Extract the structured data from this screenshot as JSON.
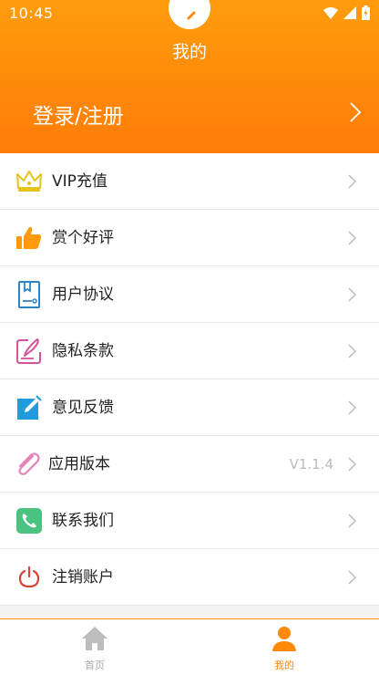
{
  "status": {
    "time": "10:45"
  },
  "header": {
    "title": "我的",
    "login_label": "登录/注册"
  },
  "menu": [
    {
      "label": "VIP充值",
      "icon": "crown-icon"
    },
    {
      "label": "赏个好评",
      "icon": "thumbs-up-icon"
    },
    {
      "label": "用户协议",
      "icon": "document-icon"
    },
    {
      "label": "隐私条款",
      "icon": "pen-note-icon"
    },
    {
      "label": "意见反馈",
      "icon": "edit-icon"
    },
    {
      "label": "应用版本",
      "icon": "paperclip-icon",
      "value": "V1.1.4"
    },
    {
      "label": "联系我们",
      "icon": "phone-icon"
    },
    {
      "label": "注销账户",
      "icon": "power-icon"
    }
  ],
  "tabs": [
    {
      "label": "首页",
      "icon": "home-icon"
    },
    {
      "label": "我的",
      "icon": "user-icon",
      "active": true
    }
  ],
  "colors": {
    "accent": "#ff8a0a",
    "active_tab": "#ff8a0a",
    "inactive_tab": "#bdbdbd"
  }
}
